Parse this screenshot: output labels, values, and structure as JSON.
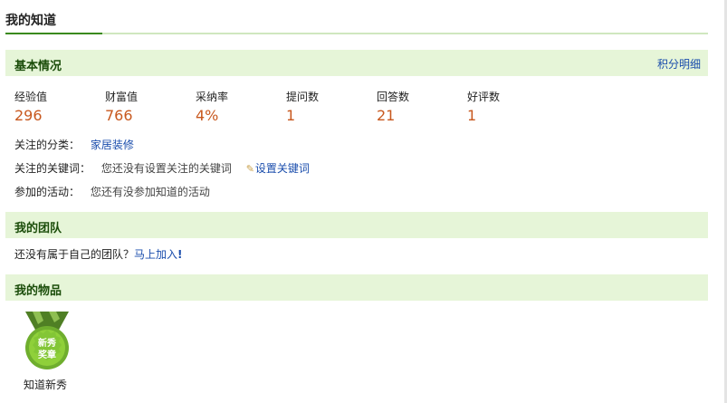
{
  "page": {
    "title": "我的知道"
  },
  "basic": {
    "title": "基本情况",
    "detail_link": "积分明细",
    "stats": [
      {
        "label": "经验值",
        "value": "296"
      },
      {
        "label": "财富值",
        "value": "766"
      },
      {
        "label": "采纳率",
        "value": "4%"
      },
      {
        "label": "提问数",
        "value": "1"
      },
      {
        "label": "回答数",
        "value": "21"
      },
      {
        "label": "好评数",
        "value": "1"
      }
    ],
    "category_label": "关注的分类：",
    "category_value": "家居装修",
    "keywords_label": "关注的关键词：",
    "keywords_value": "您还没有设置关注的关键词",
    "keywords_link": "设置关键词",
    "activities_label": "参加的活动：",
    "activities_value": "您还有没参加知道的活动"
  },
  "team": {
    "title": "我的团队",
    "text": "还没有属于自己的团队？",
    "join_link": "马上加入",
    "join_suffix": "!"
  },
  "items": {
    "title": "我的物品",
    "list": [
      {
        "badge_line1": "新秀",
        "badge_line2": "奖章",
        "name": "知道新秀"
      }
    ]
  },
  "colors": {
    "accent_green": "#3a8a1a",
    "section_bg": "#e6f5d8",
    "value_orange": "#c8581e",
    "link_blue": "#1a4dac"
  }
}
